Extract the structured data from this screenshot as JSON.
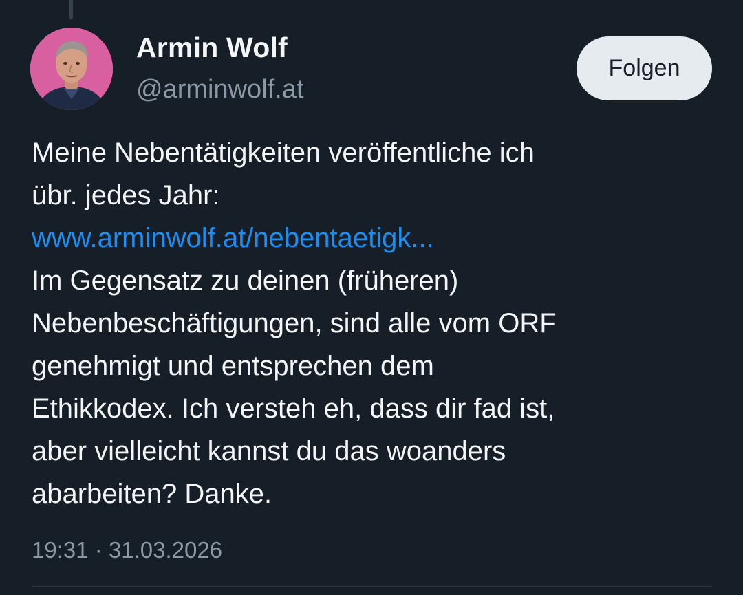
{
  "post": {
    "author": {
      "display_name": "Armin Wolf",
      "handle": "@arminwolf.at",
      "avatar_icon": "profile-photo"
    },
    "follow_label": "Folgen",
    "text_lines": [
      "Meine Nebentätigkeiten veröffentliche ich",
      "übr. jedes Jahr:"
    ],
    "link_text": "www.arminwolf.at/nebentaetigk...",
    "text_lines_after_link": [
      "Im Gegensatz zu deinen (früheren)",
      "Nebenbeschäftigungen, sind alle vom ORF",
      "genehmigt und entsprechen dem",
      "Ethikkodex. Ich versteh eh, dass dir fad ist,",
      "aber vielleicht kannst du das woanders",
      "abarbeiten? Danke."
    ],
    "timestamp": "19:31 · 31.03.2026"
  },
  "colors": {
    "background": "#161e27",
    "link": "#1d8ff0",
    "secondary_text": "#8b98a5",
    "follow_button_bg": "#e6ebef",
    "avatar_bg": "#d85aa0"
  }
}
